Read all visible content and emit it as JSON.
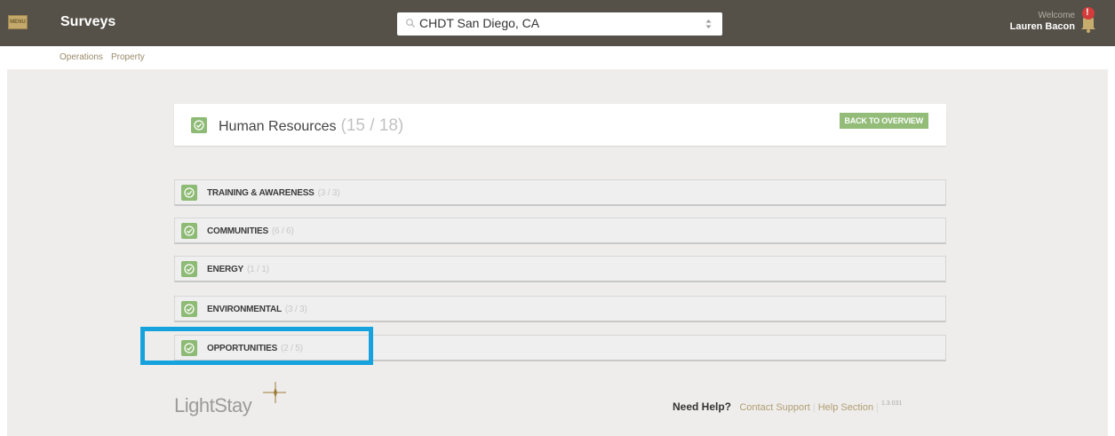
{
  "topbar": {
    "menu_label": "MENU",
    "title": "Surveys",
    "property_selector": {
      "value": "CHDT San Diego, CA"
    },
    "welcome_label": "Welcome",
    "user_name": "Lauren Bacon",
    "alert_badge": "!"
  },
  "subnav": {
    "items": [
      {
        "label": "Operations"
      },
      {
        "label": "Property"
      }
    ]
  },
  "header": {
    "title": "Human Resources",
    "count": "(15 / 18)",
    "back_button": "BACK TO OVERVIEW"
  },
  "sections": [
    {
      "label": "TRAINING & AWARENESS",
      "count": "(3 / 3)"
    },
    {
      "label": "COMMUNITIES",
      "count": "(6 / 6)"
    },
    {
      "label": "ENERGY",
      "count": "(1 / 1)"
    },
    {
      "label": "ENVIRONMENTAL",
      "count": "(3 / 3)"
    },
    {
      "label": "OPPORTUNITIES",
      "count": "(2 / 5)"
    }
  ],
  "footer": {
    "logo_text": "LightStay",
    "need_help": "Need Help?",
    "contact_support": "Contact Support",
    "help_section": "Help Section",
    "version": "1.3.031"
  },
  "colors": {
    "topbar": "#555149",
    "accent_green": "#8dba74",
    "highlight": "#16a3dd",
    "link": "#b09d74"
  },
  "icons": [
    "menu-icon",
    "search-icon",
    "up-down-arrows-icon",
    "bell-icon",
    "check-circle-icon",
    "lightstay-spark-icon"
  ]
}
